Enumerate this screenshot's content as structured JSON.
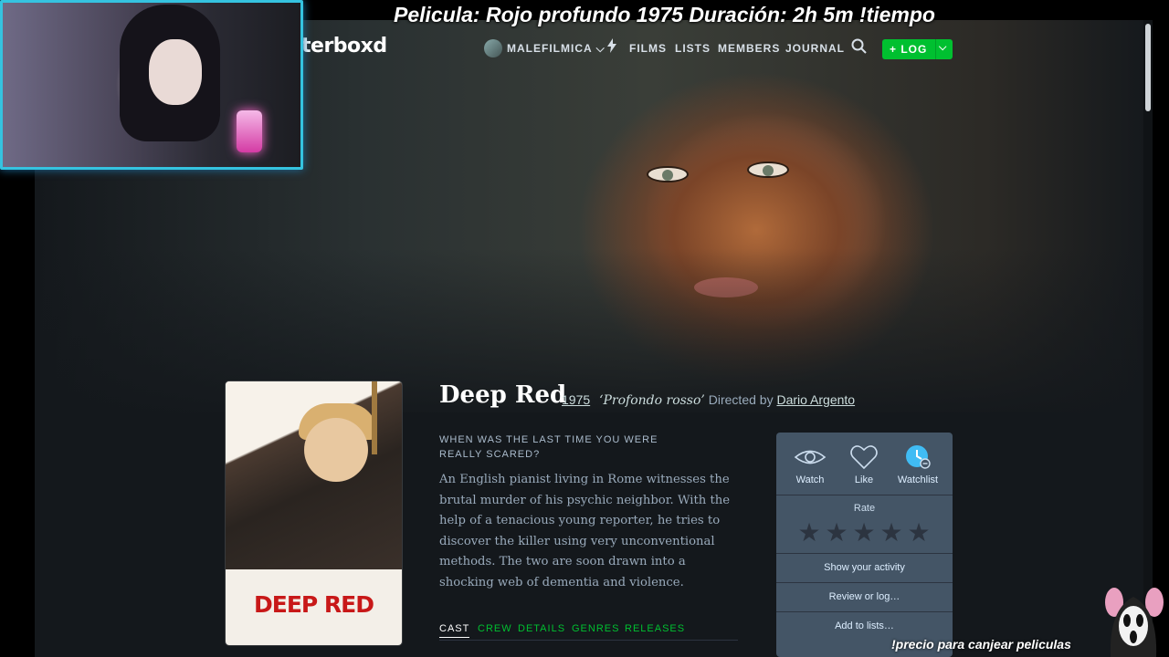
{
  "overlay": {
    "title": "Pelicula: Rojo profundo 1975 Duración: 2h 5m  !tiempo",
    "redeem": "!precio para canjear peliculas"
  },
  "nav": {
    "logo": "tterboxd",
    "user": "MALEFILMICA",
    "user_caret": "⌵",
    "items": [
      "FILMS",
      "LISTS",
      "MEMBERS",
      "JOURNAL"
    ],
    "log_button": "+ LOG",
    "log_caret": "⌵"
  },
  "film": {
    "title": "Deep Red",
    "year": "1975",
    "original_title": "‘Profondo rosso’",
    "directed_by": "Directed by",
    "director": "Dario Argento",
    "poster_title": "DEEP RED",
    "tagline": "WHEN WAS THE LAST TIME YOU WERE REALLY SCARED?",
    "synopsis": "An English pianist living in Rome witnesses the brutal murder of his psychic neighbor. With the help of a tenacious young reporter, he tries to discover the killer using very unconventional methods. The two are soon drawn into a shocking web of dementia and violence."
  },
  "tabs": [
    "CAST",
    "CREW",
    "DETAILS",
    "GENRES",
    "RELEASES"
  ],
  "actions": {
    "watch": "Watch",
    "like": "Like",
    "watchlist": "Watchlist",
    "rate": "Rate",
    "stars": [
      "★",
      "★",
      "★",
      "★",
      "★"
    ],
    "show_activity": "Show your activity",
    "review": "Review or log…",
    "add_lists": "Add to lists…"
  },
  "colors": {
    "accent_green": "#00c030",
    "panel": "#445566",
    "page_bg": "#14181c",
    "watchlist_active": "#40bcf4"
  }
}
